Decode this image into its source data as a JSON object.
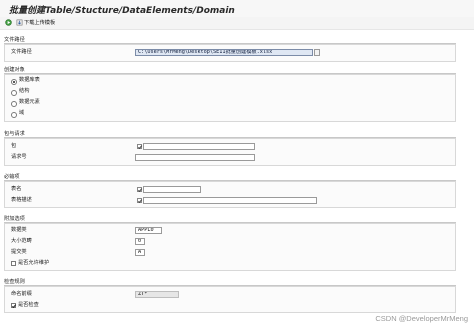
{
  "window": {
    "title": "批量创建Table/Stucture/DataElements/Domain"
  },
  "toolbar": {
    "execute_icon": "execute-icon",
    "download_icon": "download-icon",
    "download_label": "下载上传模板"
  },
  "sections": {
    "file_path": {
      "title": "文件路径",
      "path_label": "文件路径",
      "path_value": "C:\\Users\\MrMeng\\Desktop\\SE11批量创建模板.xlsx"
    },
    "create_object": {
      "title": "创建对象",
      "options": [
        "数据库表",
        "结构",
        "数据元素",
        "域"
      ],
      "selected": "数据库表"
    },
    "package_request": {
      "title": "包与请求",
      "package_label": "包",
      "request_label": "请求号"
    },
    "required": {
      "title": "必输项",
      "table_name_label": "表名",
      "table_desc_label": "表格描述"
    },
    "additional": {
      "title": "附加选项",
      "data_class_label": "数据类",
      "data_class_value": "APPL0",
      "size_label": "大小范畴",
      "size_value": "0",
      "delivery_label": "提交类",
      "delivery_value": "A",
      "maint_label": "是否允许维护",
      "maint_checked": false
    },
    "check": {
      "title": "检查规则",
      "prefix_label": "命名前缀",
      "prefix_value": "ZT*",
      "check_label": "是否检查",
      "check_checked": true
    }
  },
  "watermark": "CSDN @DeveloperMrMeng"
}
